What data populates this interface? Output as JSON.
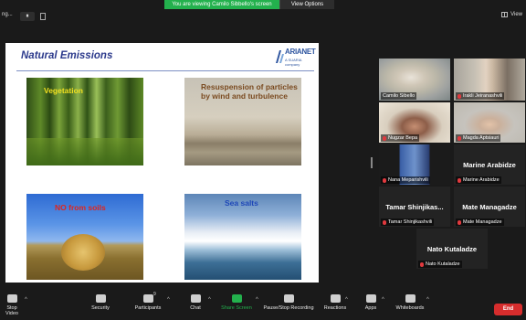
{
  "banner": {
    "text": "You are viewing Camilo Sibbello's screen",
    "options_label": "View Options"
  },
  "topbar": {
    "meeting_title": "ng...",
    "pause_symbol": "⏸",
    "view_label": "View"
  },
  "slide": {
    "title": "Natural Emissions",
    "logo_text": "ARIANET",
    "logo_sub": "A SUARIA company",
    "labels": {
      "vegetation": "Vegetation",
      "resuspension": "Resuspension of particles by wind and turbulence",
      "soils": "NO from soils",
      "sea": "Sea salts"
    }
  },
  "participants": [
    {
      "name": "Camilo Sibello",
      "muted": false,
      "active": true
    },
    {
      "name": "Irakli Jeiranashvili",
      "muted": true
    },
    {
      "name": "Nugzar Bepa",
      "muted": true
    },
    {
      "name": "Magda Aptsiauri",
      "muted": true
    },
    {
      "name": "Nana Meparishvili",
      "muted": true
    },
    {
      "name": "Marine Arabidze",
      "display_name": "Marine Arabidze",
      "muted": true
    },
    {
      "name": "Tamar Shinjikashvili",
      "display_name": "Tamar Shinjikas...",
      "muted": true
    },
    {
      "name": "Mate Managadze",
      "display_name": "Mate Managadze",
      "muted": true
    },
    {
      "name": "Nato Kutaladze",
      "display_name": "Nato Kutaladze",
      "muted": true
    }
  ],
  "toolbar": {
    "stop_video": "Stop Video",
    "security": "Security",
    "participants": "Participants",
    "participants_count": "9",
    "chat": "Chat",
    "share_screen": "Share Screen",
    "pause_recording": "Pause/Stop Recording",
    "reactions": "Reactions",
    "apps": "Apps",
    "whiteboards": "Whiteboards",
    "end": "End",
    "caret": "^"
  },
  "colors": {
    "accent_green": "#23b14d",
    "end_red": "#d72d2d",
    "active_outline": "#b6d22a"
  }
}
